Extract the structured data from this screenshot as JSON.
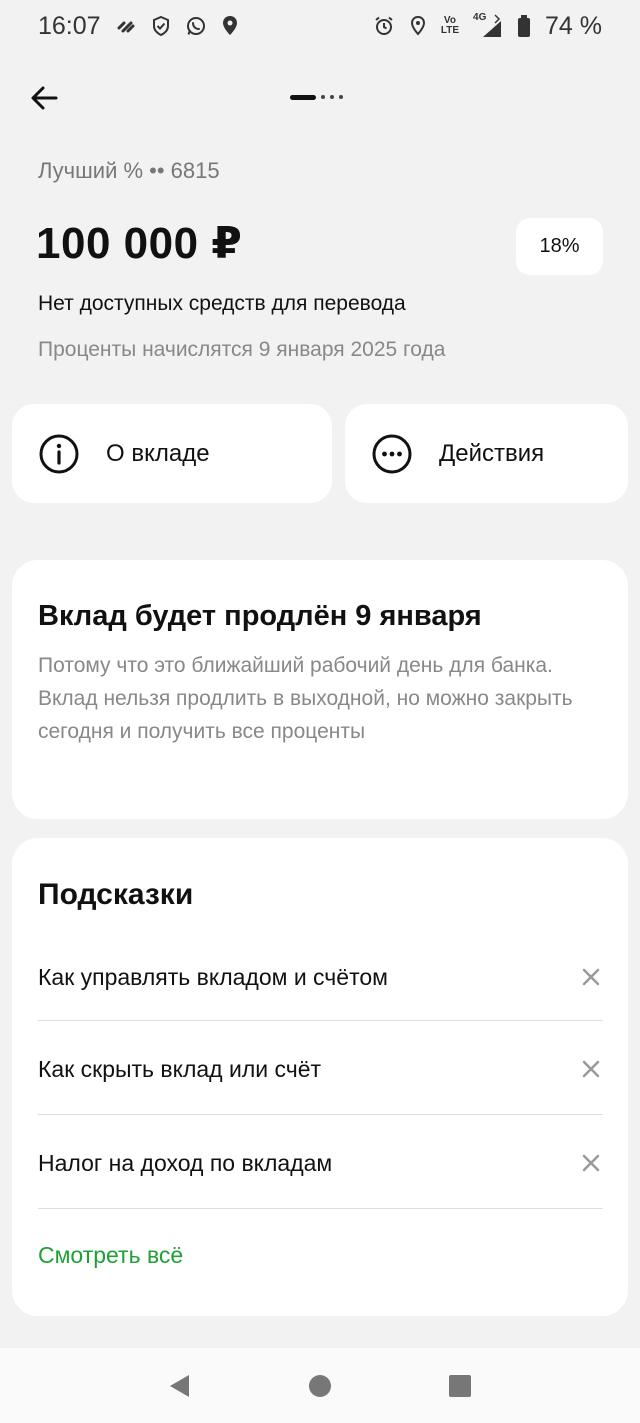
{
  "status_bar": {
    "time": "16:07",
    "network_volte": "Vo",
    "network_lte": "LTE",
    "network_4g": "4G",
    "battery": "74 %",
    "icons": [
      "chevrons-icon",
      "shield-check-icon",
      "whatsapp-icon",
      "location-pin-icon",
      "alarm-icon",
      "location-outline-icon",
      "signal-icon",
      "battery-icon"
    ]
  },
  "header": {
    "back_icon": "arrow-left-icon"
  },
  "account": {
    "subtitle": "Лучший % •• 6815",
    "amount": "100 000 ₽",
    "rate": "18%",
    "note": "Нет доступных средств для перевода",
    "interest_date": "Проценты начислятся 9 января 2025 года"
  },
  "actions": {
    "about_label": "О вкладе",
    "about_icon": "info-icon",
    "actions_label": "Действия",
    "actions_icon": "more-icon"
  },
  "info_card": {
    "title": "Вклад будет продлён 9 января",
    "text": "Потому что это ближайший рабочий день для банка. Вклад нельзя продлить в выходной, но можно закрыть сегодня и получить все проценты"
  },
  "tips": {
    "title": "Подсказки",
    "items": [
      {
        "label": "Как управлять вкладом и счётом"
      },
      {
        "label": "Как скрыть вклад или счёт"
      },
      {
        "label": "Налог на доход по вкладам"
      }
    ],
    "see_all": "Смотреть всё"
  },
  "colors": {
    "background": "#f2f2f2",
    "card": "#ffffff",
    "accent_green": "#21a038",
    "secondary_text": "#888888"
  }
}
